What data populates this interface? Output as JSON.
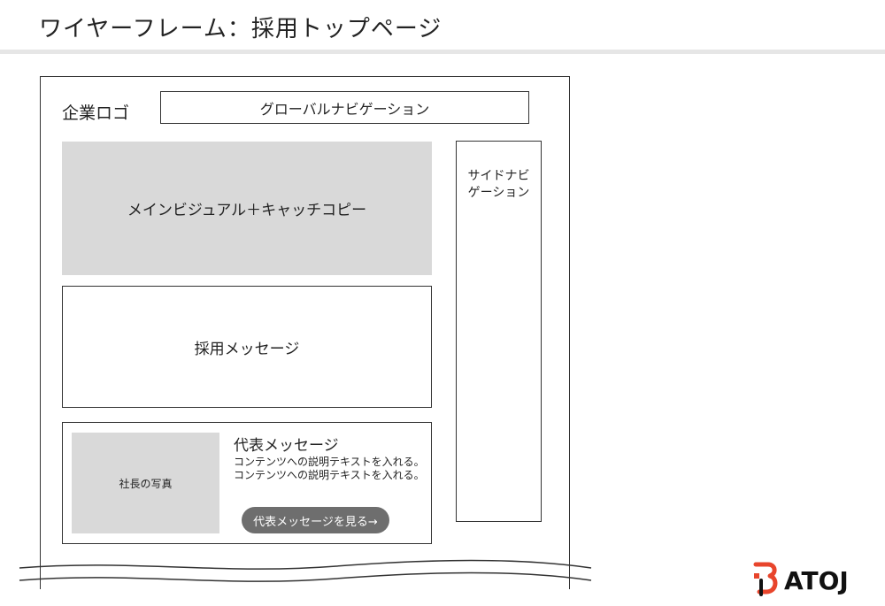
{
  "page": {
    "title": "ワイヤーフレーム：採用トップページ"
  },
  "header": {
    "logo_label": "企業ロゴ",
    "global_nav_label": "グローバルナビゲーション"
  },
  "main": {
    "hero_label": "メインビジュアル＋キャッチコピー",
    "recruit_message_label": "採用メッセージ",
    "ceo": {
      "photo_label": "社長の写真",
      "title": "代表メッセージ",
      "description": "コンテンツへの説明テキストを入れる。コンテンツへの説明テキストを入れる。",
      "button_label": "代表メッセージを見る→"
    }
  },
  "sidebar": {
    "label_line1": "サイドナビ",
    "label_line2": "ゲーション"
  },
  "brand": {
    "name": "ATOJ",
    "accent_color": "#e8452c",
    "text_color": "#111111"
  }
}
